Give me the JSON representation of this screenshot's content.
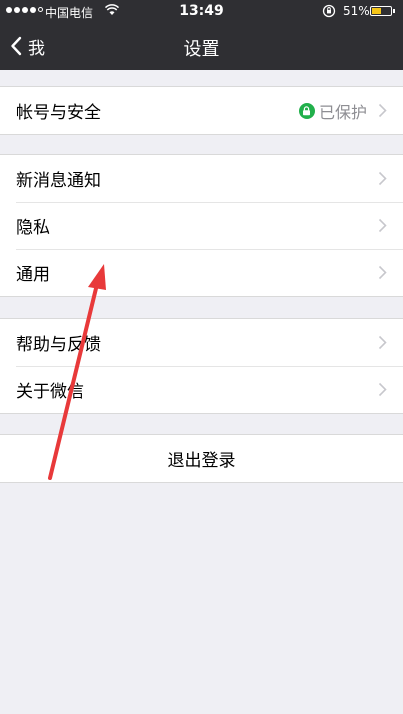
{
  "status_bar": {
    "carrier": "中国电信",
    "time": "13:49",
    "battery_percent": "51%",
    "battery_level": 0.51,
    "battery_color": "#f5c518",
    "signal_bars_filled": 4,
    "signal_bars_total": 5
  },
  "nav": {
    "back_label": "我",
    "title": "设置"
  },
  "sections": {
    "account": {
      "label": "帐号与安全",
      "status": "已保护",
      "status_icon": "lock-icon",
      "status_color": "#21b04b"
    },
    "notify": {
      "label": "新消息通知"
    },
    "privacy": {
      "label": "隐私"
    },
    "general": {
      "label": "通用"
    },
    "help": {
      "label": "帮助与反馈"
    },
    "about": {
      "label": "关于微信"
    },
    "logout": {
      "label": "退出登录"
    }
  },
  "annotation": {
    "type": "red-arrow",
    "color": "#e8393a",
    "points_to": "通用"
  }
}
